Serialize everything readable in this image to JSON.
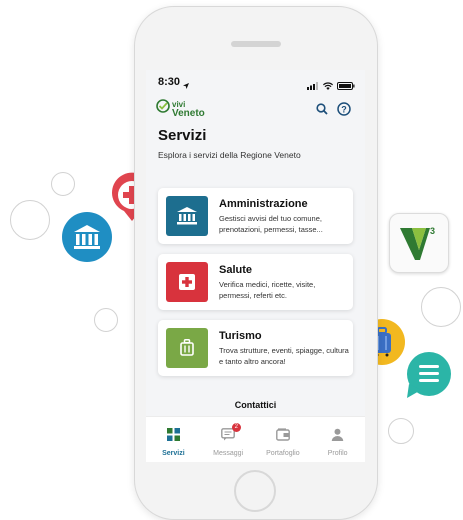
{
  "status_bar": {
    "time": "8:30"
  },
  "brand": {
    "line1": "vivi",
    "line2": "Veneto"
  },
  "page": {
    "title": "Servizi",
    "subtitle": "Esplora i servizi della Regione Veneto"
  },
  "services": [
    {
      "title": "Amministrazione",
      "description": "Gestisci avvisi del tuo comune, prenotazioni, permessi, tasse...",
      "icon": "bank-icon",
      "color": "#1d6e8f"
    },
    {
      "title": "Salute",
      "description": "Verifica medici, ricette, visite, permessi, referti etc.",
      "icon": "health-cross-icon",
      "color": "#d8333d"
    },
    {
      "title": "Turismo",
      "description": "Trova strutture, eventi, spiagge, cultura e tanto altro ancora!",
      "icon": "suitcase-icon",
      "color": "#7aa846"
    }
  ],
  "contacts_label": "Contattici",
  "tabs": [
    {
      "label": "Servizi",
      "active": true,
      "icon": "grid-icon"
    },
    {
      "label": "Messaggi",
      "badge": "2",
      "icon": "message-icon"
    },
    {
      "label": "Portafoglio",
      "icon": "wallet-icon"
    },
    {
      "label": "Profilo",
      "icon": "user-icon"
    }
  ],
  "colors": {
    "accent": "#1d7095",
    "brand_green": "#2f7a32",
    "red": "#d8333d",
    "green": "#7aa846",
    "teal": "#1d6e8f"
  }
}
